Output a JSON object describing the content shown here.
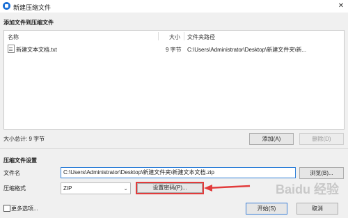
{
  "window": {
    "title": "新建压缩文件",
    "close_glyph": "✕"
  },
  "add_section": {
    "title": "添加文件到压缩文件"
  },
  "list": {
    "headers": {
      "name": "名称",
      "size": "大小",
      "path": "文件夹路径"
    },
    "rows": [
      {
        "name": "新建文本文档.txt",
        "size": "9 字节",
        "path": "C:\\Users\\Administrator\\Desktop\\新建文件夹\\新..."
      }
    ]
  },
  "total": {
    "label": "大小总计: 9 字节"
  },
  "buttons": {
    "add": "添加(A)",
    "delete": "删除(D)",
    "browse": "浏览(B)...",
    "set_password": "设置密码(P)...",
    "start": "开始(S)",
    "cancel": "取消"
  },
  "settings_section": {
    "title": "压缩文件设置"
  },
  "filename": {
    "label": "文件名",
    "value": "C:\\Users\\Administrator\\Desktop\\新建文件夹\\新建文本文档.zip"
  },
  "format": {
    "label": "压缩格式",
    "value": "ZIP",
    "chevron": "⌄"
  },
  "more_options": {
    "label": "更多选项..."
  },
  "watermark": {
    "text": "Baidu 经验"
  },
  "colors": {
    "accent": "#2f7fd8",
    "highlight": "#e23b3b",
    "arrow": "#e23b3b"
  }
}
